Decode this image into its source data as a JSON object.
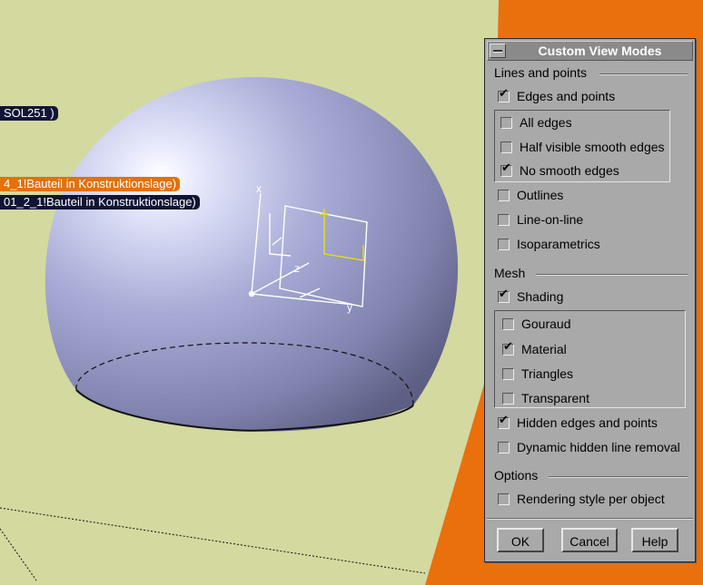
{
  "viewport": {
    "labels": [
      {
        "text": "SOL251 )"
      },
      {
        "text": "4_1!Bauteil in Konstruktionslage)"
      },
      {
        "text": "01_2_1!Bauteil in Konstruktionslage)"
      }
    ],
    "axis_labels": {
      "x": "x",
      "y": "y",
      "z": "z"
    },
    "colors": {
      "background": "#d3d99f",
      "orange": "#e9700c",
      "sphere": "#a8acd6"
    }
  },
  "dialog": {
    "title": "Custom View Modes",
    "sections": {
      "lines_and_points": "Lines and points",
      "mesh": "Mesh",
      "options": "Options"
    },
    "options": {
      "edges_and_points": {
        "label": "Edges and points",
        "checked": true
      },
      "all_edges": {
        "label": "All edges",
        "checked": false
      },
      "half_visible_smooth_edges": {
        "label": "Half visible smooth edges",
        "checked": false
      },
      "no_smooth_edges": {
        "label": "No smooth edges",
        "checked": true
      },
      "outlines": {
        "label": "Outlines",
        "checked": false
      },
      "line_on_line": {
        "label": "Line-on-line",
        "checked": false
      },
      "isoparametrics": {
        "label": "Isoparametrics",
        "checked": false
      },
      "shading": {
        "label": "Shading",
        "checked": true
      },
      "gouraud": {
        "label": "Gouraud",
        "checked": false
      },
      "material": {
        "label": "Material",
        "checked": true
      },
      "triangles": {
        "label": "Triangles",
        "checked": false
      },
      "transparent": {
        "label": "Transparent",
        "checked": false
      },
      "hidden_edges_and_points": {
        "label": "Hidden edges and points",
        "checked": true
      },
      "dynamic_hidden_line_removal": {
        "label": "Dynamic hidden line removal",
        "checked": false
      },
      "rendering_style_per_object": {
        "label": "Rendering style per object",
        "checked": false
      }
    },
    "buttons": {
      "ok": "OK",
      "cancel": "Cancel",
      "help": "Help"
    }
  }
}
